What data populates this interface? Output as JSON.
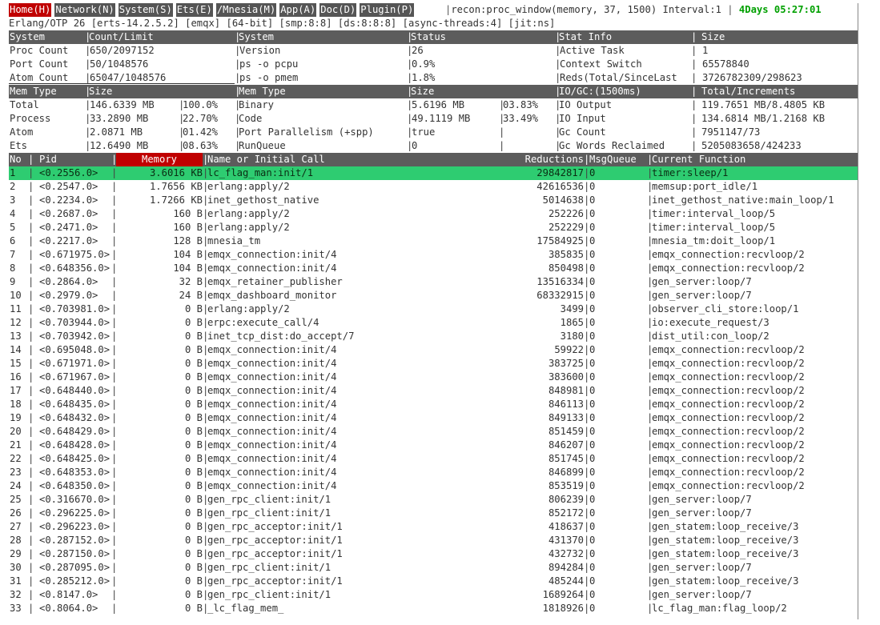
{
  "menu": {
    "items": [
      {
        "label": "Home(H)",
        "active": true
      },
      {
        "label": "Network(N)",
        "active": false
      },
      {
        "label": "System(S)",
        "active": false
      },
      {
        "label": "Ets(E)",
        "active": false
      },
      {
        "label": "/Mnesia(M)",
        "active": false
      },
      {
        "label": "App(A)",
        "active": false
      },
      {
        "label": "Doc(D)",
        "active": false
      },
      {
        "label": "Plugin(P)",
        "active": false
      }
    ],
    "command": "recon:proc_window(memory, 37, 1500) Interval:1",
    "uptime": "4Days 05:27:01"
  },
  "otp_line": "Erlang/OTP 26 [erts-14.2.5.2] [emqx] [64-bit] [smp:8:8] [ds:8:8:8] [async-threads:4] [jit:ns]",
  "sys_header": [
    "System",
    "Count/Limit",
    "System",
    "Status",
    "Stat Info",
    "Size"
  ],
  "sys_rows": [
    [
      "Proc Count",
      "650/2097152",
      "Version",
      "26",
      "Active Task",
      "1"
    ],
    [
      "Port Count",
      "50/1048576",
      "ps -o pcpu",
      "0.9%",
      "Context Switch",
      "65578840"
    ],
    [
      "Atom Count",
      "65047/1048576",
      "ps -o pmem",
      "1.8%",
      "Reds(Total/SinceLast",
      "3726782309/298623"
    ]
  ],
  "mem_header": [
    "Mem Type",
    "Size",
    "Mem Type",
    "Size",
    "IO/GC:(1500ms)",
    "Total/Increments"
  ],
  "mem_rows": [
    [
      "Total",
      "146.6339 MB",
      "100.0%",
      "Binary",
      "5.6196 MB",
      "03.83%",
      "IO Output",
      "119.7651 MB/8.4805 KB"
    ],
    [
      "Process",
      "33.2890 MB",
      "22.70%",
      "Code",
      "49.1119 MB",
      "33.49%",
      "IO Input",
      "134.6814 MB/1.2168 KB"
    ],
    [
      "Atom",
      "2.0871 MB",
      "01.42%",
      "Port Parallelism (+spp)",
      "true",
      "",
      "Gc Count",
      "7951147/73"
    ],
    [
      "Ets",
      "12.6490 MB",
      "08.63%",
      "RunQueue",
      "0",
      "",
      "Gc Words Reclaimed",
      "5205083658/424233"
    ]
  ],
  "proc_header": [
    "No",
    "Pid",
    "Memory",
    "Name or Initial Call",
    "Reductions",
    "MsgQueue",
    "Current Function"
  ],
  "proc_rows": [
    [
      "1",
      "<0.2556.0>",
      "3.6016 KB",
      "lc_flag_man:init/1",
      "29842817",
      "0",
      "timer:sleep/1"
    ],
    [
      "2",
      "<0.2547.0>",
      "1.7656 KB",
      "erlang:apply/2",
      "42616536",
      "0",
      "memsup:port_idle/1"
    ],
    [
      "3",
      "<0.2234.0>",
      "1.7266 KB",
      "inet_gethost_native",
      "5014638",
      "0",
      "inet_gethost_native:main_loop/1"
    ],
    [
      "4",
      "<0.2687.0>",
      "160 B",
      "erlang:apply/2",
      "252226",
      "0",
      "timer:interval_loop/5"
    ],
    [
      "5",
      "<0.2471.0>",
      "160 B",
      "erlang:apply/2",
      "252229",
      "0",
      "timer:interval_loop/5"
    ],
    [
      "6",
      "<0.2217.0>",
      "128 B",
      "mnesia_tm",
      "17584925",
      "0",
      "mnesia_tm:doit_loop/1"
    ],
    [
      "7",
      "<0.671975.0>",
      "104 B",
      "emqx_connection:init/4",
      "385835",
      "0",
      "emqx_connection:recvloop/2"
    ],
    [
      "8",
      "<0.648356.0>",
      "104 B",
      "emqx_connection:init/4",
      "850498",
      "0",
      "emqx_connection:recvloop/2"
    ],
    [
      "9",
      "<0.2864.0>",
      "32 B",
      "emqx_retainer_publisher",
      "13516334",
      "0",
      "gen_server:loop/7"
    ],
    [
      "10",
      "<0.2979.0>",
      "24 B",
      "emqx_dashboard_monitor",
      "68332915",
      "0",
      "gen_server:loop/7"
    ],
    [
      "11",
      "<0.703981.0>",
      "0 B",
      "erlang:apply/2",
      "3499",
      "0",
      "observer_cli_store:loop/1"
    ],
    [
      "12",
      "<0.703944.0>",
      "0 B",
      "erpc:execute_call/4",
      "1865",
      "0",
      "io:execute_request/3"
    ],
    [
      "13",
      "<0.703942.0>",
      "0 B",
      "inet_tcp_dist:do_accept/7",
      "3180",
      "0",
      "dist_util:con_loop/2"
    ],
    [
      "14",
      "<0.695048.0>",
      "0 B",
      "emqx_connection:init/4",
      "59922",
      "0",
      "emqx_connection:recvloop/2"
    ],
    [
      "15",
      "<0.671971.0>",
      "0 B",
      "emqx_connection:init/4",
      "383725",
      "0",
      "emqx_connection:recvloop/2"
    ],
    [
      "16",
      "<0.671967.0>",
      "0 B",
      "emqx_connection:init/4",
      "383600",
      "0",
      "emqx_connection:recvloop/2"
    ],
    [
      "17",
      "<0.648440.0>",
      "0 B",
      "emqx_connection:init/4",
      "848981",
      "0",
      "emqx_connection:recvloop/2"
    ],
    [
      "18",
      "<0.648435.0>",
      "0 B",
      "emqx_connection:init/4",
      "846113",
      "0",
      "emqx_connection:recvloop/2"
    ],
    [
      "19",
      "<0.648432.0>",
      "0 B",
      "emqx_connection:init/4",
      "849133",
      "0",
      "emqx_connection:recvloop/2"
    ],
    [
      "20",
      "<0.648429.0>",
      "0 B",
      "emqx_connection:init/4",
      "851459",
      "0",
      "emqx_connection:recvloop/2"
    ],
    [
      "21",
      "<0.648428.0>",
      "0 B",
      "emqx_connection:init/4",
      "846207",
      "0",
      "emqx_connection:recvloop/2"
    ],
    [
      "22",
      "<0.648425.0>",
      "0 B",
      "emqx_connection:init/4",
      "851745",
      "0",
      "emqx_connection:recvloop/2"
    ],
    [
      "23",
      "<0.648353.0>",
      "0 B",
      "emqx_connection:init/4",
      "846899",
      "0",
      "emqx_connection:recvloop/2"
    ],
    [
      "24",
      "<0.648350.0>",
      "0 B",
      "emqx_connection:init/4",
      "853519",
      "0",
      "emqx_connection:recvloop/2"
    ],
    [
      "25",
      "<0.316670.0>",
      "0 B",
      "gen_rpc_client:init/1",
      "806239",
      "0",
      "gen_server:loop/7"
    ],
    [
      "26",
      "<0.296225.0>",
      "0 B",
      "gen_rpc_client:init/1",
      "852172",
      "0",
      "gen_server:loop/7"
    ],
    [
      "27",
      "<0.296223.0>",
      "0 B",
      "gen_rpc_acceptor:init/1",
      "418637",
      "0",
      "gen_statem:loop_receive/3"
    ],
    [
      "28",
      "<0.287152.0>",
      "0 B",
      "gen_rpc_acceptor:init/1",
      "431370",
      "0",
      "gen_statem:loop_receive/3"
    ],
    [
      "29",
      "<0.287150.0>",
      "0 B",
      "gen_rpc_acceptor:init/1",
      "432732",
      "0",
      "gen_statem:loop_receive/3"
    ],
    [
      "30",
      "<0.287095.0>",
      "0 B",
      "gen_rpc_client:init/1",
      "894284",
      "0",
      "gen_server:loop/7"
    ],
    [
      "31",
      "<0.285212.0>",
      "0 B",
      "gen_rpc_acceptor:init/1",
      "485244",
      "0",
      "gen_statem:loop_receive/3"
    ],
    [
      "32",
      "<0.8147.0>",
      "0 B",
      "gen_rpc_client:init/1",
      "1689264",
      "0",
      "gen_server:loop/7"
    ],
    [
      "33",
      "<0.8064.0>",
      "0 B",
      "_lc_flag_mem_",
      "1818926",
      "0",
      "lc_flag_man:flag_loop/2"
    ]
  ],
  "selected_row": 0
}
